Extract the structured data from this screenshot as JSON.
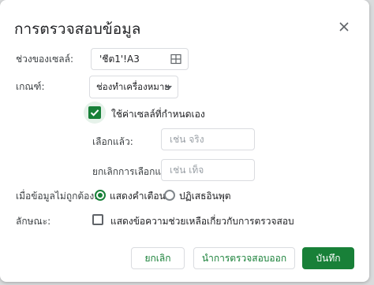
{
  "dialog": {
    "title": "การตรวจสอบข้อมูล"
  },
  "range": {
    "label": "ช่วงของเซลล์:",
    "value": "'ชีต1'!A3"
  },
  "criteria": {
    "label": "เกณฑ์:",
    "selected": "ช่องทำเครื่องหมาย"
  },
  "custom_values": {
    "label": "ใช้ค่าเซลล์ที่กำหนดเอง",
    "checked": true
  },
  "checked_value": {
    "label": "เลือกแล้ว:",
    "placeholder": "เช่น จริง"
  },
  "unchecked_value": {
    "label": "ยกเลิกการเลือกแล้ว:",
    "placeholder": "เช่น เท็จ"
  },
  "invalid_data": {
    "label": "เมื่อข้อมูลไม่ถูกต้อง:",
    "options": [
      "แสดงคำเตือน",
      "ปฏิเสธอินพุต"
    ],
    "selected": "แสดงคำเตือน"
  },
  "appearance": {
    "label": "ลักษณะ:",
    "help_text_label": "แสดงข้อความช่วยเหลือเกี่ยวกับการตรวจสอบ",
    "checked": false
  },
  "buttons": {
    "cancel": "ยกเลิก",
    "remove": "นำการตรวจสอบออก",
    "save": "บันทึก"
  },
  "colors": {
    "accent": "#188038"
  }
}
